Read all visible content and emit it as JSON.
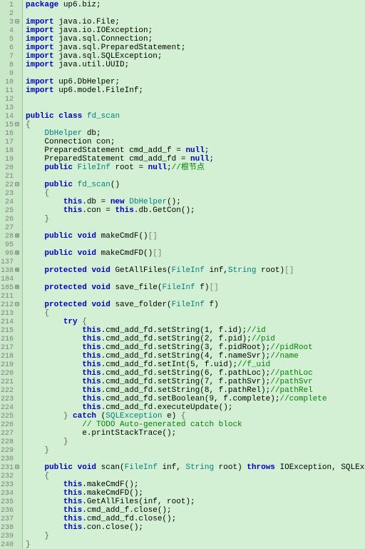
{
  "lines": [
    {
      "n": "1",
      "f": "",
      "code": "<span class='kw'>package</span> up6.biz;"
    },
    {
      "n": "2",
      "f": "",
      "code": ""
    },
    {
      "n": "3",
      "f": "-",
      "code": "<span class='kw'>import</span> java.io.File;"
    },
    {
      "n": "4",
      "f": "",
      "code": "<span class='kw'>import</span> java.io.IOException;"
    },
    {
      "n": "5",
      "f": "",
      "code": "<span class='kw'>import</span> java.sql.Connection;"
    },
    {
      "n": "6",
      "f": "",
      "code": "<span class='kw'>import</span> java.sql.PreparedStatement;"
    },
    {
      "n": "7",
      "f": "",
      "code": "<span class='kw'>import</span> java.sql.SQLException;"
    },
    {
      "n": "8",
      "f": "",
      "code": "<span class='kw'>import</span> java.util.UUID;"
    },
    {
      "n": "9",
      "f": "",
      "code": ""
    },
    {
      "n": "10",
      "f": "",
      "code": "<span class='kw'>import</span> up6.DbHelper;"
    },
    {
      "n": "11",
      "f": "",
      "code": "<span class='kw'>import</span> up6.model.FileInf;"
    },
    {
      "n": "12",
      "f": "",
      "code": ""
    },
    {
      "n": "13",
      "f": "",
      "code": ""
    },
    {
      "n": "14",
      "f": "",
      "code": "<span class='kw'>public</span> <span class='kw'>class</span> <span class='type'>fd_scan</span>"
    },
    {
      "n": "15",
      "f": "-",
      "code": "<span class='br'>{</span>"
    },
    {
      "n": "16",
      "f": "",
      "code": "    <span class='type'>DbHelper</span> db;"
    },
    {
      "n": "17",
      "f": "",
      "code": "    Connection con;"
    },
    {
      "n": "18",
      "f": "",
      "code": "    PreparedStatement cmd_add_f = <span class='kw'>null</span>;"
    },
    {
      "n": "19",
      "f": "",
      "code": "    PreparedStatement cmd_add_fd = <span class='kw'>null</span>;"
    },
    {
      "n": "20",
      "f": "",
      "code": "    <span class='kw'>public</span> <span class='type'>FileInf</span> root = <span class='kw'>null</span>;<span class='cm'>//根节点</span>"
    },
    {
      "n": "21",
      "f": "",
      "code": ""
    },
    {
      "n": "22",
      "f": "-",
      "code": "    <span class='kw'>public</span> <span class='type'>fd_scan</span>()"
    },
    {
      "n": "23",
      "f": "",
      "code": "    <span class='br'>{</span>"
    },
    {
      "n": "24",
      "f": "",
      "code": "        <span class='kw'>this</span>.db = <span class='kw'>new</span> <span class='type'>DbHelper</span>();"
    },
    {
      "n": "25",
      "f": "",
      "code": "        <span class='kw'>this</span>.con = <span class='kw'>this</span>.db.GetCon();"
    },
    {
      "n": "26",
      "f": "",
      "code": "    <span class='br'>}</span>"
    },
    {
      "n": "27",
      "f": "",
      "code": ""
    },
    {
      "n": "28",
      "f": "+",
      "code": "    <span class='kw'>public</span> <span class='kw'>void</span> makeCmdF()<span class='gray'>[]</span>"
    },
    {
      "n": "95",
      "f": "",
      "code": ""
    },
    {
      "n": "96",
      "f": "+",
      "code": "    <span class='kw'>public</span> <span class='kw'>void</span> makeCmdFD()<span class='gray'>[]</span>"
    },
    {
      "n": "137",
      "f": "",
      "code": ""
    },
    {
      "n": "138",
      "f": "+",
      "code": "    <span class='kw'>protected</span> <span class='kw'>void</span> GetAllFiles(<span class='type'>FileInf</span> inf,<span class='type'>String</span> root)<span class='gray'>[]</span>"
    },
    {
      "n": "184",
      "f": "",
      "code": ""
    },
    {
      "n": "185",
      "f": "+",
      "code": "    <span class='kw'>protected</span> <span class='kw'>void</span> save_file(<span class='type'>FileInf</span> f)<span class='gray'>[]</span>"
    },
    {
      "n": "211",
      "f": "",
      "code": ""
    },
    {
      "n": "212",
      "f": "-",
      "code": "    <span class='kw'>protected</span> <span class='kw'>void</span> save_folder(<span class='type'>FileInf</span> f)"
    },
    {
      "n": "213",
      "f": "",
      "code": "    <span class='br'>{</span>"
    },
    {
      "n": "214",
      "f": "",
      "code": "        <span class='kw'>try</span> <span class='br'>{</span>"
    },
    {
      "n": "215",
      "f": "",
      "code": "            <span class='kw'>this</span>.cmd_add_fd.setString(1, f.id);<span class='cm'>//id</span>"
    },
    {
      "n": "216",
      "f": "",
      "code": "            <span class='kw'>this</span>.cmd_add_fd.setString(2, f.pid);<span class='cm'>//pid</span>"
    },
    {
      "n": "217",
      "f": "",
      "code": "            <span class='kw'>this</span>.cmd_add_fd.setString(3, f.pidRoot);<span class='cm'>//pidRoot</span>"
    },
    {
      "n": "218",
      "f": "",
      "code": "            <span class='kw'>this</span>.cmd_add_fd.setString(4, f.nameSvr);<span class='cm'>//name</span>"
    },
    {
      "n": "219",
      "f": "",
      "code": "            <span class='kw'>this</span>.cmd_add_fd.setInt(5, f.uid);<span class='cm'>//f_uid</span>"
    },
    {
      "n": "220",
      "f": "",
      "code": "            <span class='kw'>this</span>.cmd_add_fd.setString(6, f.pathLoc);<span class='cm'>//pathLoc</span>"
    },
    {
      "n": "221",
      "f": "",
      "code": "            <span class='kw'>this</span>.cmd_add_fd.setString(7, f.pathSvr);<span class='cm'>//pathSvr</span>"
    },
    {
      "n": "222",
      "f": "",
      "code": "            <span class='kw'>this</span>.cmd_add_fd.setString(8, f.pathRel);<span class='cm'>//pathRel</span>"
    },
    {
      "n": "223",
      "f": "",
      "code": "            <span class='kw'>this</span>.cmd_add_fd.setBoolean(9, f.complete);<span class='cm'>//complete</span>"
    },
    {
      "n": "224",
      "f": "",
      "code": "            <span class='kw'>this</span>.cmd_add_fd.executeUpdate();"
    },
    {
      "n": "225",
      "f": "",
      "code": "        <span class='br'>}</span> <span class='kw'>catch</span> (<span class='type'>SQLException</span> e) <span class='br'>{</span>"
    },
    {
      "n": "226",
      "f": "",
      "code": "            <span class='cm'>// TODO Auto-generated catch block</span>"
    },
    {
      "n": "227",
      "f": "",
      "code": "            e.printStackTrace();"
    },
    {
      "n": "228",
      "f": "",
      "code": "        <span class='br'>}</span>"
    },
    {
      "n": "229",
      "f": "",
      "code": "    <span class='br'>}</span>"
    },
    {
      "n": "230",
      "f": "",
      "code": ""
    },
    {
      "n": "231",
      "f": "-",
      "code": "    <span class='kw'>public</span> <span class='kw'>void</span> scan(<span class='type'>FileInf</span> inf, <span class='type'>String</span> root) <span class='kw'>throws</span> IOException, SQLException"
    },
    {
      "n": "232",
      "f": "",
      "code": "    <span class='br'>{</span>"
    },
    {
      "n": "233",
      "f": "",
      "code": "        <span class='kw'>this</span>.makeCmdF();"
    },
    {
      "n": "234",
      "f": "",
      "code": "        <span class='kw'>this</span>.makeCmdFD();"
    },
    {
      "n": "235",
      "f": "",
      "code": "        <span class='kw'>this</span>.GetAllFiles(inf, root);"
    },
    {
      "n": "236",
      "f": "",
      "code": "        <span class='kw'>this</span>.cmd_add_f.close();"
    },
    {
      "n": "237",
      "f": "",
      "code": "        <span class='kw'>this</span>.cmd_add_fd.close();"
    },
    {
      "n": "238",
      "f": "",
      "code": "        <span class='kw'>this</span>.con.close();"
    },
    {
      "n": "239",
      "f": "",
      "code": "    <span class='br'>}</span>"
    },
    {
      "n": "240",
      "f": "",
      "code": "<span class='br'>}</span>"
    }
  ]
}
